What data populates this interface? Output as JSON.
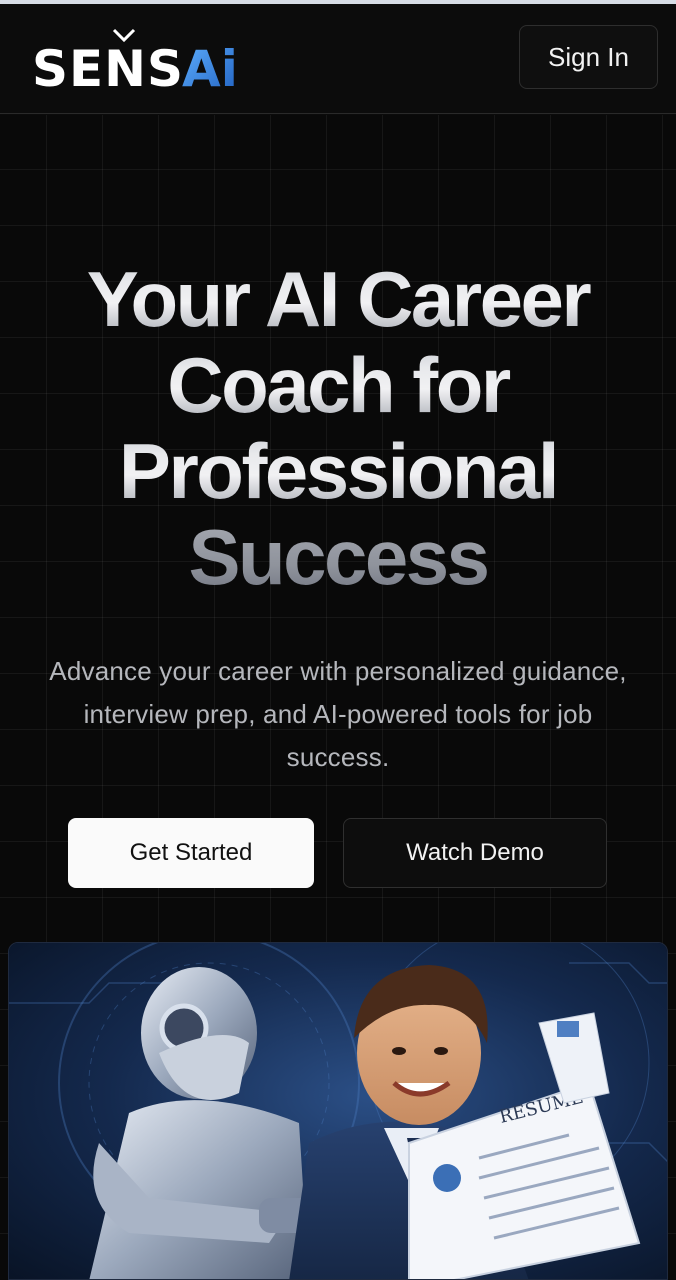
{
  "brand": {
    "logo_text": "SENSAi",
    "accent_color": "#2f7fd6"
  },
  "header": {
    "signin_label": "Sign In"
  },
  "hero": {
    "headline_lines": [
      "Your AI Career",
      "Coach for",
      "Professional",
      "Success"
    ],
    "subtitle_lines": [
      "Advance your career with personalized guidance,",
      "interview prep, and AI-powered tools for job",
      "success."
    ],
    "primary_cta": "Get Started",
    "secondary_cta": "Watch Demo"
  },
  "illustration": {
    "resume_heading": "RESUME"
  }
}
